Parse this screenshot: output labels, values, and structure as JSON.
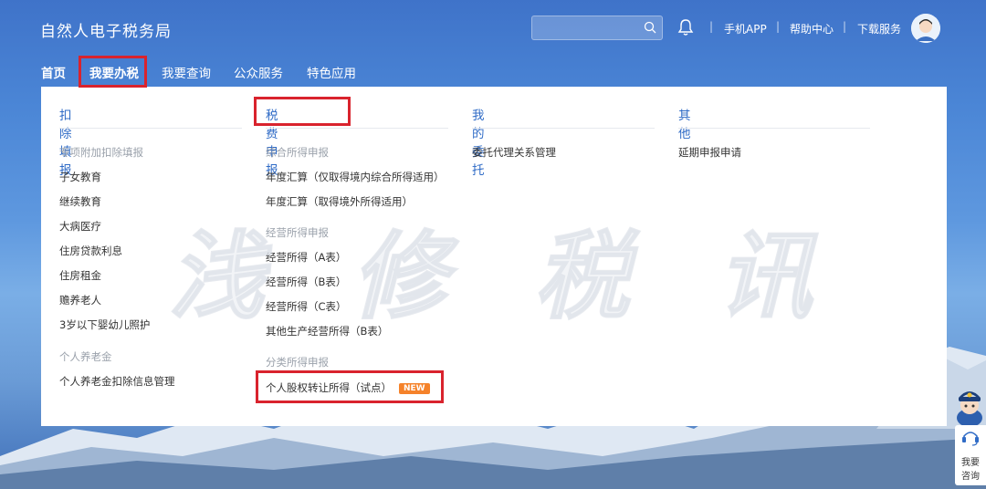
{
  "header": {
    "site_title": "自然人电子税务局",
    "links": [
      "手机APP",
      "帮助中心",
      "下载服务"
    ]
  },
  "nav": {
    "items": [
      "首页",
      "我要办税",
      "我要查询",
      "公众服务",
      "特色应用"
    ]
  },
  "menu": {
    "col1": {
      "title": "扣除填报",
      "group1": "专项附加扣除填报",
      "items1": [
        "子女教育",
        "继续教育",
        "大病医疗",
        "住房贷款利息",
        "住房租金",
        "赡养老人",
        "3岁以下婴幼儿照护"
      ],
      "group2": "个人养老金",
      "items2": [
        "个人养老金扣除信息管理"
      ]
    },
    "col2": {
      "title": "税费申报",
      "group1": "综合所得申报",
      "items1": [
        "年度汇算（仅取得境内综合所得适用）",
        "年度汇算（取得境外所得适用）"
      ],
      "group2": "经营所得申报",
      "items2": [
        "经营所得（A表）",
        "经营所得（B表）",
        "经营所得（C表）",
        "其他生产经营所得（B表）"
      ],
      "group3": "分类所得申报",
      "items3": [
        "个人股权转让所得（试点）"
      ],
      "badge": "NEW"
    },
    "col3": {
      "title": "我的委托",
      "items": [
        "委托代理关系管理"
      ]
    },
    "col4": {
      "title": "其他",
      "items": [
        "延期申报申请"
      ]
    }
  },
  "watermark": "浅 修 税 讯",
  "side_widget": {
    "line1": "我要",
    "line2": "咨询"
  },
  "colors": {
    "accent": "#2f6bc6",
    "highlight": "#d9232d",
    "badge": "#f5822a"
  }
}
